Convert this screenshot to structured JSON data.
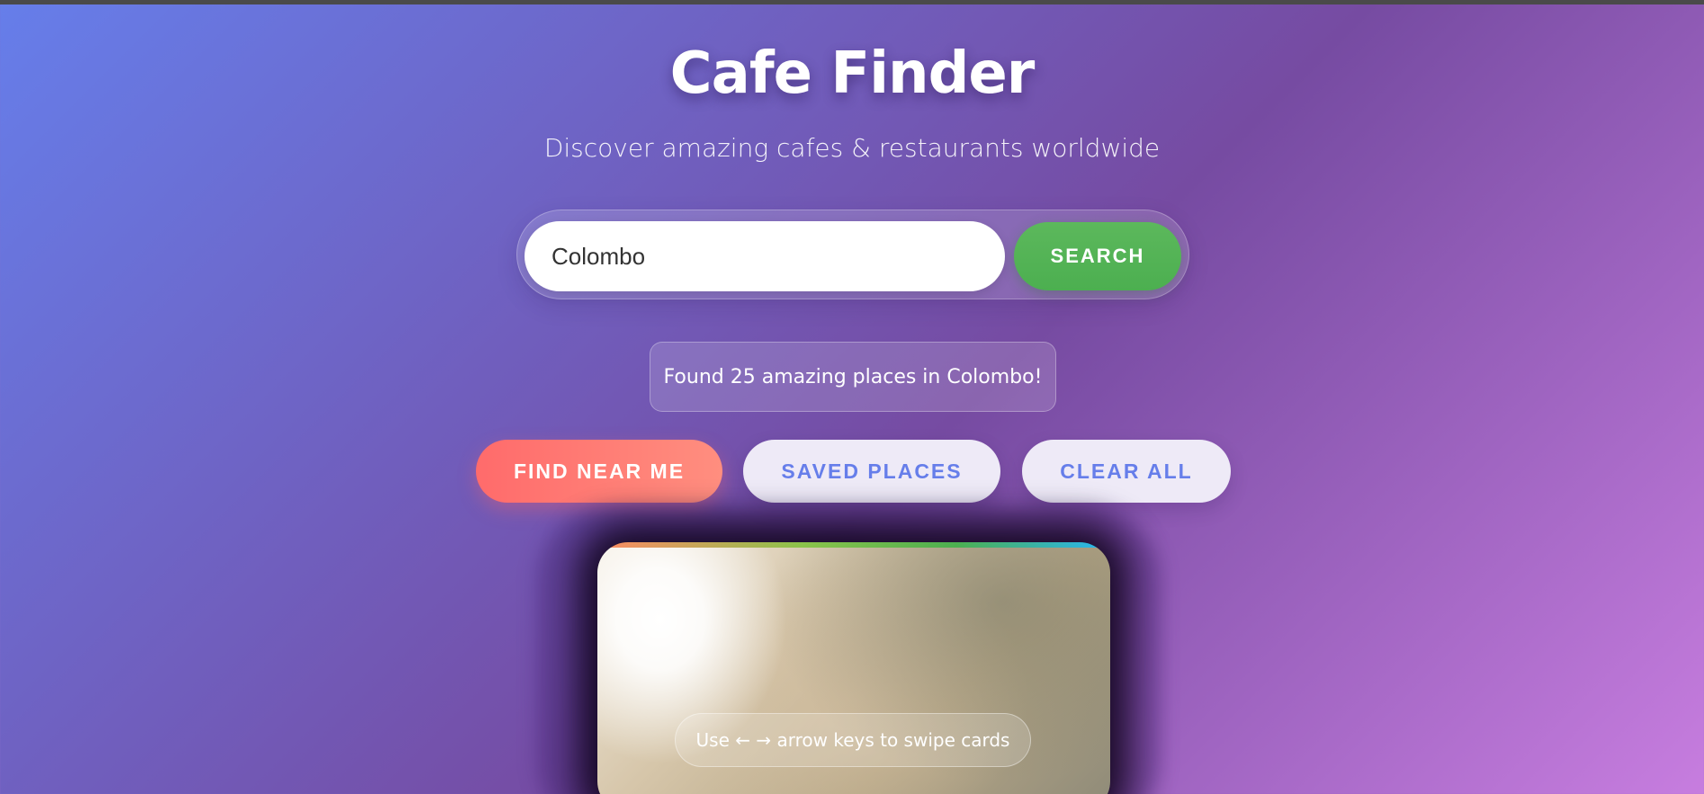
{
  "header": {
    "title": "Cafe Finder",
    "subtitle": "Discover amazing cafes & restaurants worldwide"
  },
  "search": {
    "value": "Colombo",
    "button_label": "SEARCH"
  },
  "status": {
    "message": "Found 25 amazing places in Colombo!"
  },
  "actions": {
    "find_near_label": "FIND NEAR ME",
    "saved_label": "SAVED PLACES",
    "clear_label": "CLEAR ALL"
  },
  "card": {
    "hint": "Use ← → arrow keys to swipe cards"
  },
  "colors": {
    "background_start": "#667eea",
    "background_end": "#c77ddf",
    "search_button": "#4caf50",
    "find_near_button": "#ff6b6b",
    "secondary_button_text": "#667eea"
  }
}
